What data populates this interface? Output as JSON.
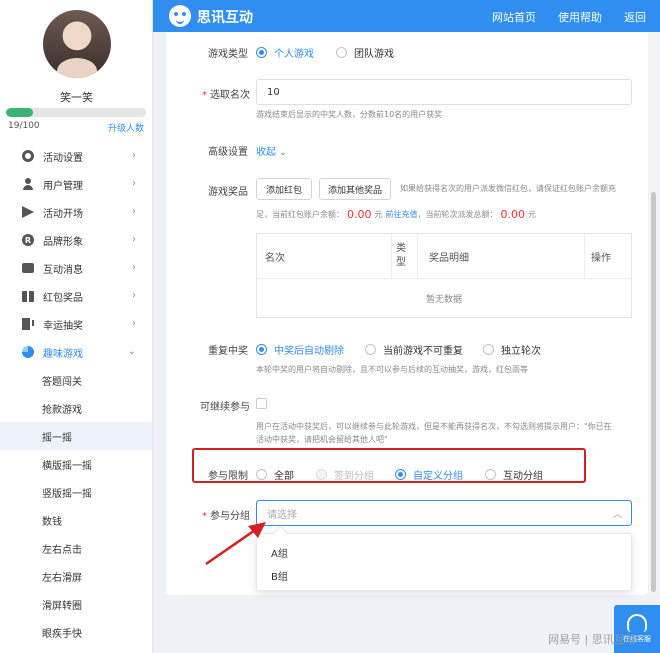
{
  "header": {
    "brand": "思讯互动",
    "nav": [
      "网站首页",
      "使用帮助",
      "返回"
    ]
  },
  "user": {
    "name": "笑一笑",
    "progress_text": "19/100",
    "progress_fraction": 0.19,
    "upgrade_label": "升级人数"
  },
  "sidebar": {
    "items": [
      {
        "label": "活动设置",
        "icon": "gear-icon"
      },
      {
        "label": "用户管理",
        "icon": "user-icon"
      },
      {
        "label": "活动开场",
        "icon": "paper-plane-icon"
      },
      {
        "label": "品牌形象",
        "icon": "registered-icon"
      },
      {
        "label": "互动消息",
        "icon": "message-icon"
      },
      {
        "label": "红包奖品",
        "icon": "gift-icon"
      },
      {
        "label": "幸运抽奖",
        "icon": "slot-machine-icon"
      },
      {
        "label": "趣味游戏",
        "icon": "pie-chart-icon"
      }
    ],
    "r_letter": "R",
    "sub_items": [
      "答题闯关",
      "抢款游戏",
      "摇一摇",
      "横版摇一摇",
      "竖版摇一摇",
      "数钱",
      "左右点击",
      "左右滑屏",
      "滑屏转圈",
      "眼疾手快"
    ]
  },
  "form": {
    "game_type": {
      "label": "游戏类型",
      "options": [
        "个人游戏",
        "团队游戏"
      ]
    },
    "winners": {
      "label": "选取名次",
      "value": "10",
      "hint": "游戏结束后显示的中奖人数，分数前10名的用户获奖"
    },
    "advanced": {
      "label": "高级设置",
      "toggle": "收起"
    },
    "prizes": {
      "label": "游戏奖品",
      "btn_add_red": "添加红包",
      "btn_add_other": "添加其他奖品",
      "note": "如果给获得名次的用户派发微信红包，请保证红包账户余额充",
      "line2_pre": "足，当前红包账户余额：",
      "balance": "0.00",
      "unit": "元",
      "recharge": "前往充值",
      "line2_mid": "，当前轮次派发总额：",
      "total": "0.00",
      "table_headers": [
        "名次",
        "类型",
        "奖品明细",
        "操作"
      ],
      "empty": "暂无数据"
    },
    "repeat": {
      "label": "重复中奖",
      "options": [
        "中奖后自动剔除",
        "当前游戏不可重复",
        "独立轮次"
      ],
      "hint": "本轮中奖的用户将自动剔除，且不可以参与后续的互动抽奖，游戏，红包雨等"
    },
    "continue": {
      "label": "可继续参与",
      "hint1": "用户在活动中获奖后，可以继续参与此轮游戏，但是不能再获得名次，不勾选则将提示用户：\"你已在",
      "hint2": "活动中获奖，请把机会留给其他人吧\""
    },
    "limit": {
      "label": "参与限制",
      "options": [
        "全部",
        "签到分组",
        "自定义分组",
        "互动分组"
      ]
    },
    "group": {
      "label": "参与分组",
      "placeholder": "请选择",
      "options": [
        "A组",
        "B组"
      ]
    },
    "required_mark": "*"
  },
  "help": {
    "label": "在线客服"
  },
  "watermark": "网易号 | 思讯互动",
  "colors": {
    "accent": "#2f8ef0",
    "danger": "#e33",
    "highlight_box": "#d32020"
  }
}
